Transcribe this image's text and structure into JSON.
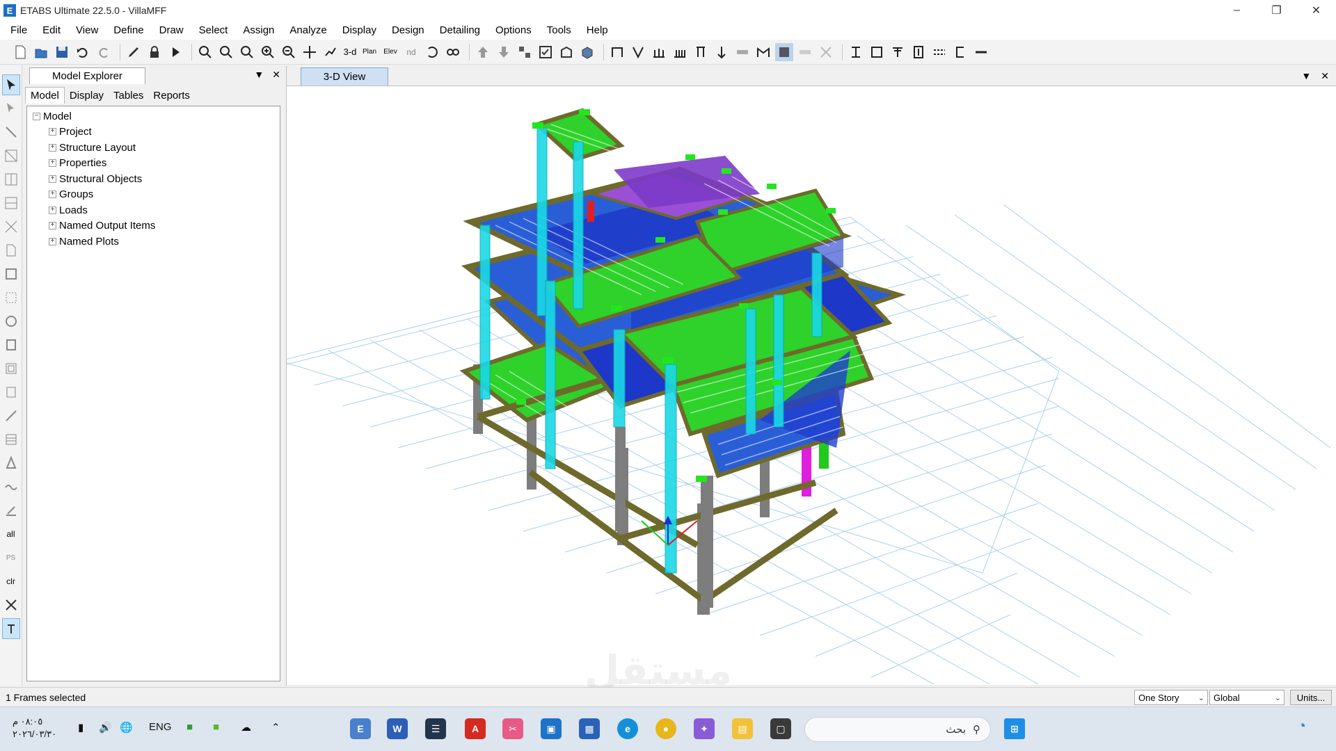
{
  "window": {
    "title": "ETABS Ultimate 22.5.0 - VillaMFF",
    "app_icon": "E"
  },
  "menu": [
    "File",
    "Edit",
    "View",
    "Define",
    "Draw",
    "Select",
    "Assign",
    "Analyze",
    "Display",
    "Design",
    "Detailing",
    "Options",
    "Tools",
    "Help"
  ],
  "toolbar": {
    "view_3d_label": "3-d",
    "plan_label": "Plan",
    "elev_label": "Elev",
    "nd_label": "nd"
  },
  "explorer": {
    "tab_label": "Model Explorer",
    "subtabs": [
      "Model",
      "Display",
      "Tables",
      "Reports"
    ],
    "root": "Model",
    "nodes": [
      "Project",
      "Structure Layout",
      "Properties",
      "Structural Objects",
      "Groups",
      "Loads",
      "Named Output Items",
      "Named Plots"
    ]
  },
  "view": {
    "tab_label": "3-D View"
  },
  "lefttools_labels": {
    "all": "all",
    "ps": "PS",
    "clr": "clr"
  },
  "status": {
    "message": "1 Frames selected",
    "story_option": "One Story",
    "coord_option": "Global",
    "units_button": "Units..."
  },
  "watermark": "مستقل",
  "taskbar": {
    "time": "٠٨:٠٥ م",
    "date": "٢٠٢٦/٠٣/٣٠",
    "language": "ENG",
    "search_placeholder": "بحث"
  },
  "colors": {
    "slab_blue": "#1a4fd1",
    "slab_green": "#22c91e",
    "column_cyan": "#19d9e6",
    "beam_olive": "#6e6a2c",
    "grid": "#9cc9e8"
  }
}
